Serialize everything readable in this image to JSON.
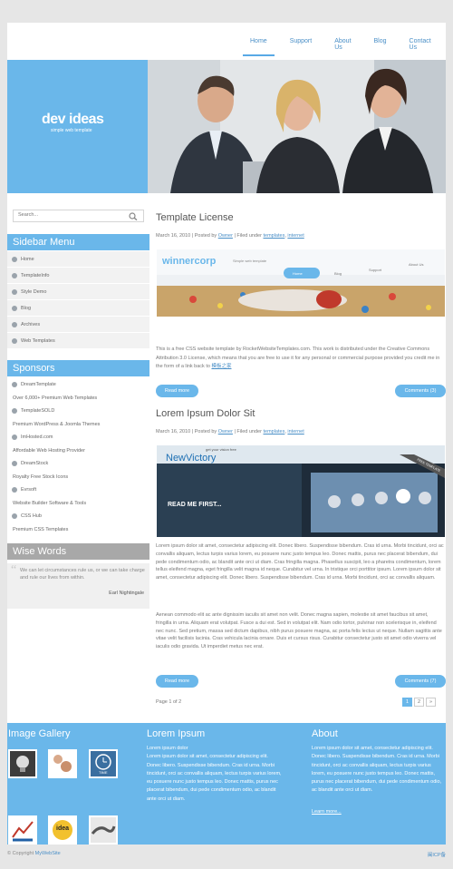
{
  "nav": [
    "Home",
    "Support",
    "About Us",
    "Blog",
    "Contact Us"
  ],
  "logo": {
    "name": "dev ideas",
    "tagline": "simple web template"
  },
  "search": {
    "placeholder": "Search..."
  },
  "sidebar_menu": {
    "title": "Sidebar Menu",
    "items": [
      "Home",
      "TemplateInfo",
      "Style Demo",
      "Blog",
      "Archives",
      "Web Templates"
    ]
  },
  "sponsors": {
    "title": "Sponsors",
    "items": [
      {
        "name": "DreamTemplate",
        "desc": "Over 6,000+ Premium Web Templates"
      },
      {
        "name": "TemplateSOLD",
        "desc": "Premium WordPress & Joomla Themes"
      },
      {
        "name": "ImHosted.com",
        "desc": "Affordable Web Hosting Provider"
      },
      {
        "name": "DreamStock",
        "desc": "Royalty Free Stock Icons"
      },
      {
        "name": "Evrsoft",
        "desc": "Website Builder Software & Tools"
      },
      {
        "name": "CSS Hub",
        "desc": "Premium CSS Templates"
      }
    ]
  },
  "wise_words": {
    "title": "Wise Words",
    "quote": "We can let circumstances rule us, or we can take charge and rule our lives from within.",
    "author": "Earl Nightingale"
  },
  "posts": [
    {
      "title": "Template License",
      "date": "March 16, 2010",
      "author_prefix": "Posted by",
      "author": "Owner",
      "filed_prefix": "Filed under",
      "cat1": "templates",
      "cat2": "internet",
      "image_brand": "winnercorp",
      "image_tagline": "Simple web template",
      "image_nav": [
        "Home",
        "Blog",
        "Support",
        "About Us"
      ],
      "body": "This is a free CSS website template by RocketWebsiteTemplates.com. This work is distributed under the Creative Commons Attribution 3.0 License, which means that you are free to use it for any personal or commercial purpose provided you credit me in the form of a link back to",
      "body_link": "模板之家",
      "read_more": "Read more",
      "comments": "Comments (3)"
    },
    {
      "title": "Lorem Ipsum Dolor Sit",
      "date": "March 16, 2010",
      "author_prefix": "Posted by",
      "author": "Owner",
      "filed_prefix": "Filed under",
      "cat1": "templates",
      "cat2": "internet",
      "image_brand": "NewVictory",
      "image_tagline": "get your vision free",
      "image_headline": "READ ME FIRST...",
      "image_ribbon": "FREE TEMPLATE",
      "body1": "Lorem ipsum dolor sit amet, consectetur adipiscing elit. Donec libero. Suspendisse bibendum. Cras id urna. Morbi tincidunt, orci ac convallis aliquam, lectus turpis varius lorem, eu posuere nunc justo tempus leo. Donec mattis, purus nec placerat bibendum, dui pede condimentum odio, ac blandit ante orci ut diam. Cras fringilla magna. Phasellus suscipit, leo a pharetra condimentum, lorem tellus eleifend magna, eget fringilla velit magna id neque. Curabitur vel urna. In tristique orci porttitor ipsum. Lorem ipsum dolor sit amet, consectetur adipiscing elit. Donec libero. Suspendisse bibendum. Cras id urna. Morbi tincidunt, orci ac convallis aliquam.",
      "body2": "Aenean commodo elit ac ante dignissim iaculis sit amet non velit. Donec magna sapien, molestie sit amet faucibus sit amet, fringilla in urna. Aliquam erat volutpat. Fusce a dui est. Sed in volutpat elit. Nam odio tortor, pulvinar non scelerisque in, eleifend nec nunc. Sed pretium, massa sed dictum dapibus, nibh purus posuere magna, ac porta felis lectus ut neque. Nullam sagittis ante vitae velit facilisis lacinia. Cras vehicula lacinia ornare. Duis et cursus risus. Curabitur consectetur justo sit amet odio viverra vel iaculis odio gravida. Ut imperdiet metus nec erat.",
      "read_more": "Read more",
      "comments": "Comments (7)"
    }
  ],
  "pager": {
    "info": "Page 1 of 2",
    "pages": [
      "1",
      "2",
      "»"
    ]
  },
  "footer": {
    "gallery_title": "Image Gallery",
    "thumb_labels": [
      "TIME",
      "idea"
    ],
    "lorem_title": "Lorem Ipsum",
    "lorem_text": "Lorem ipsum dolor\nLorem ipsum dolor sit amet, consectetur adipiscing elit. Donec libero. Suspendisse bibendum. Cras id urna. Morbi tincidunt, orci ac convallis aliquam, lectus turpis varius lorem, eu posuere nunc justo tempus leo. Donec mattis, purus nec placerat bibendum, dui pede condimentum odio, ac blandit ante orci ut diam.",
    "about_title": "About",
    "about_text": "Lorem ipsum dolor sit amet, consectetur adipiscing elit. Donec libero. Suspendisse bibendum. Cras id urna. Morbi tincidunt, orci ac convallis aliquam, lectus turpis varius lorem, eu posuere nunc justo tempus leo. Donec mattis, purus nec placerat bibendum, dui pede condimentum odio, ac blandit ante orci ut diam.",
    "learn_more": "Learn more..."
  },
  "copyright": {
    "prefix": "© Copyright",
    "link": "MyWebSite"
  },
  "icp": "闽ICP备",
  "colors": {
    "accent": "#6ab7ea",
    "link": "#4a8fc7",
    "gray_head": "#a8a8a8"
  }
}
